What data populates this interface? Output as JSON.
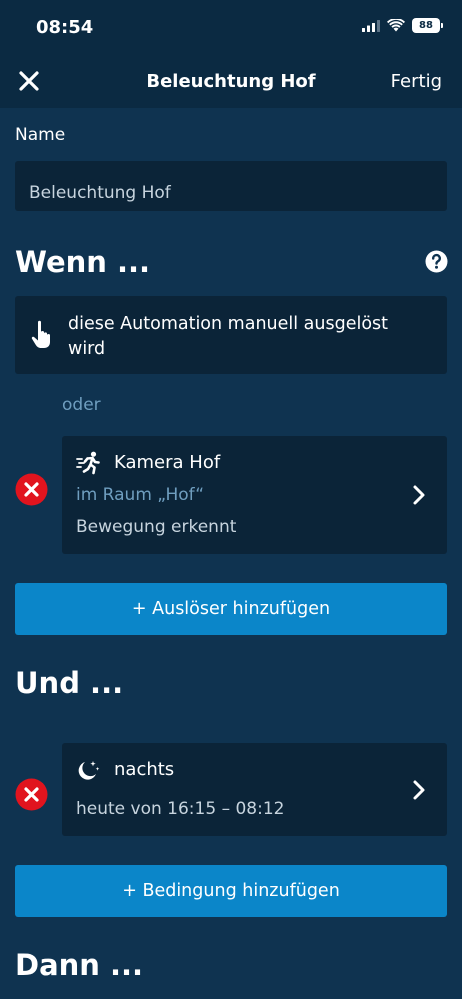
{
  "status_bar": {
    "time": "08:54",
    "battery": "88"
  },
  "nav": {
    "title": "Beleuchtung Hof",
    "done_label": "Fertig"
  },
  "name_section": {
    "label": "Name",
    "value": "Beleuchtung Hof"
  },
  "when_section": {
    "heading": "Wenn ...",
    "manual_trigger": {
      "text": "diese Automation manuell ausgelöst wird"
    },
    "or_label": "oder",
    "trigger": {
      "title": "Kamera Hof",
      "room": "im Raum „Hof“",
      "event": "Bewegung erkennt"
    },
    "add_trigger_label": "+ Auslöser hinzufügen"
  },
  "and_section": {
    "heading": "Und ...",
    "condition": {
      "title": "nachts",
      "detail": "heute von 16:15 – 08:12"
    },
    "add_condition_label": "+ Bedingung hinzufügen"
  },
  "then_section": {
    "heading": "Dann ..."
  },
  "colors": {
    "background": "#0f3350",
    "header": "#0b2a42",
    "card": "#0b2438",
    "accent": "#0b86c9",
    "danger": "#e1141e",
    "muted_text": "#6f9ebf"
  },
  "icons": {
    "close": "close-icon",
    "help": "help-icon",
    "manual": "hand-pointer-icon",
    "motion": "running-person-icon",
    "night": "moon-stars-icon",
    "remove": "remove-icon",
    "chevron": "chevron-right-icon"
  }
}
